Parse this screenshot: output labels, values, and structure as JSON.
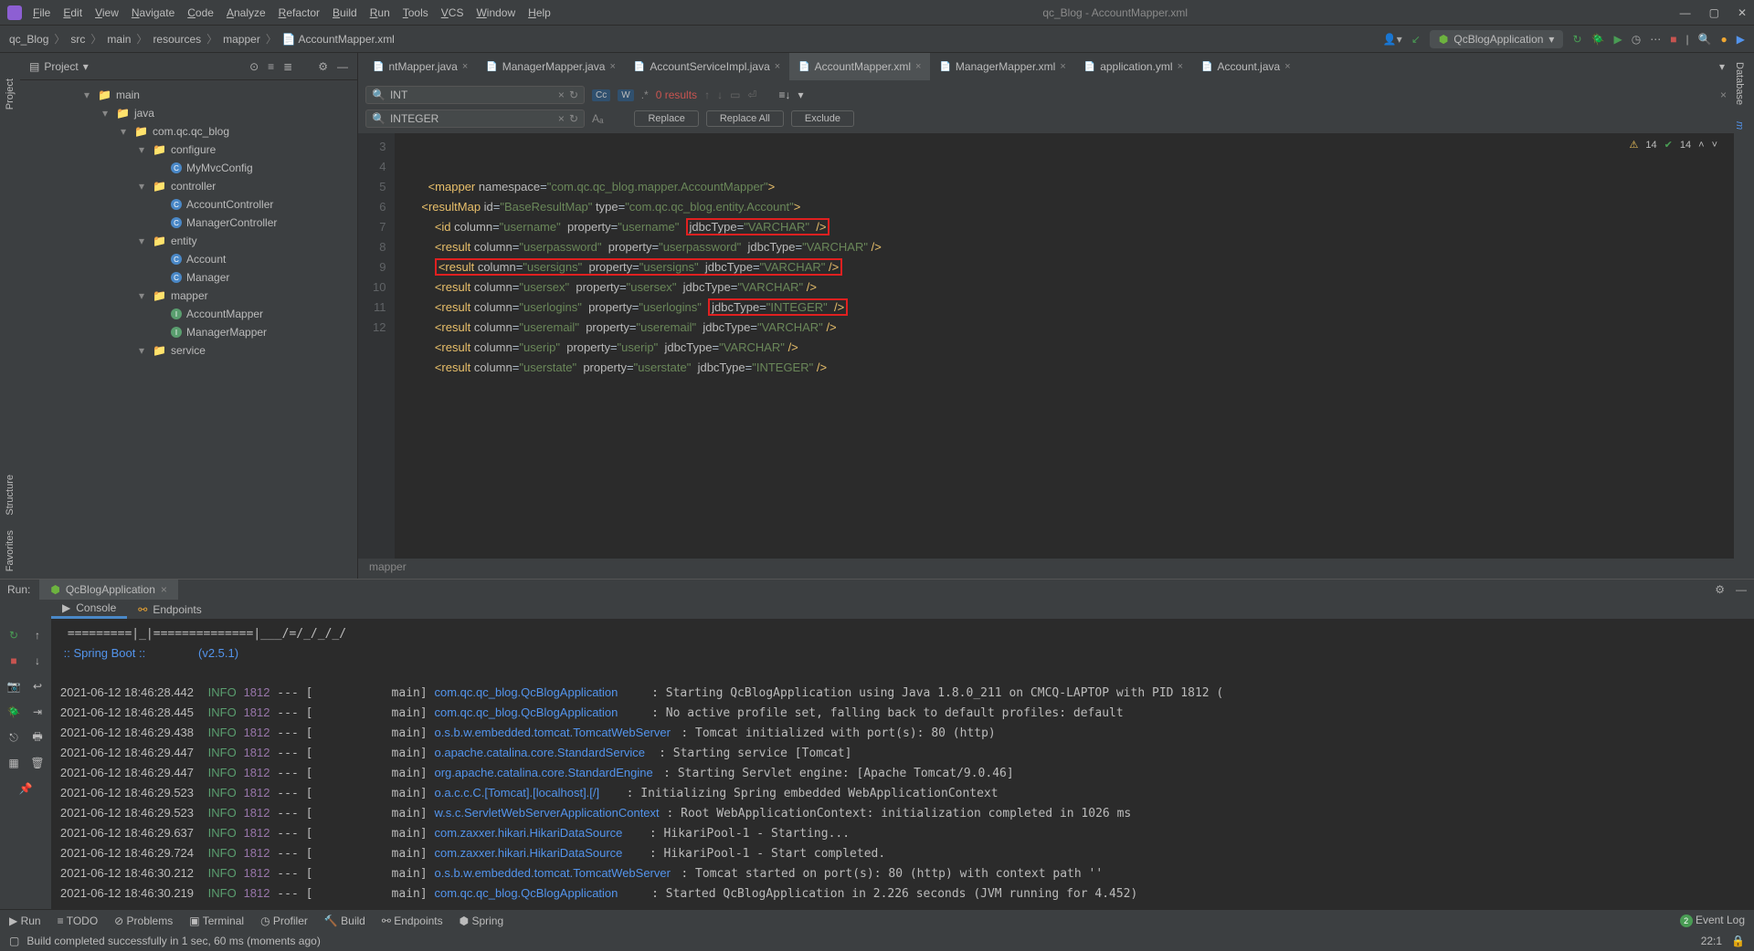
{
  "window": {
    "title": "qc_Blog - AccountMapper.xml"
  },
  "menu": [
    "File",
    "Edit",
    "View",
    "Navigate",
    "Code",
    "Analyze",
    "Refactor",
    "Build",
    "Run",
    "Tools",
    "VCS",
    "Window",
    "Help"
  ],
  "breadcrumb": [
    "qc_Blog",
    "src",
    "main",
    "resources",
    "mapper",
    "AccountMapper.xml"
  ],
  "runConfig": "QcBlogApplication",
  "projectPanel": {
    "title": "Project"
  },
  "tree": [
    {
      "indent": 70,
      "arrow": "▾",
      "icon": "folder",
      "label": "main"
    },
    {
      "indent": 90,
      "arrow": "▾",
      "icon": "folder",
      "label": "java",
      "color": "#4a88c7"
    },
    {
      "indent": 110,
      "arrow": "▾",
      "icon": "folder",
      "label": "com.qc.qc_blog"
    },
    {
      "indent": 130,
      "arrow": "▾",
      "icon": "folder",
      "label": "configure"
    },
    {
      "indent": 150,
      "arrow": "",
      "icon": "c",
      "label": "MyMvcConfig"
    },
    {
      "indent": 130,
      "arrow": "▾",
      "icon": "folder",
      "label": "controller"
    },
    {
      "indent": 150,
      "arrow": "",
      "icon": "c",
      "label": "AccountController"
    },
    {
      "indent": 150,
      "arrow": "",
      "icon": "c",
      "label": "ManagerController"
    },
    {
      "indent": 130,
      "arrow": "▾",
      "icon": "folder",
      "label": "entity"
    },
    {
      "indent": 150,
      "arrow": "",
      "icon": "c",
      "label": "Account"
    },
    {
      "indent": 150,
      "arrow": "",
      "icon": "c",
      "label": "Manager"
    },
    {
      "indent": 130,
      "arrow": "▾",
      "icon": "folder",
      "label": "mapper"
    },
    {
      "indent": 150,
      "arrow": "",
      "icon": "i",
      "label": "AccountMapper"
    },
    {
      "indent": 150,
      "arrow": "",
      "icon": "i",
      "label": "ManagerMapper"
    },
    {
      "indent": 130,
      "arrow": "▾",
      "icon": "folder",
      "label": "service"
    }
  ],
  "tabs": [
    {
      "label": "ntMapper.java",
      "active": false
    },
    {
      "label": "ManagerMapper.java",
      "active": false
    },
    {
      "label": "AccountServiceImpl.java",
      "active": false
    },
    {
      "label": "AccountMapper.xml",
      "active": true
    },
    {
      "label": "ManagerMapper.xml",
      "active": false
    },
    {
      "label": "application.yml",
      "active": false
    },
    {
      "label": "Account.java",
      "active": false
    }
  ],
  "search": {
    "find": "INT",
    "replace": "INTEGER",
    "results": "0 results",
    "buttons": [
      "Replace",
      "Replace All",
      "Exclude"
    ]
  },
  "lineNumbers": [
    "3",
    "4",
    "5",
    "6",
    "7",
    "8",
    "9",
    "10",
    "11",
    "12"
  ],
  "inspections": {
    "warn": "14",
    "pass": "14"
  },
  "code": {
    "mapperNs": "com.qc.qc_blog.mapper.AccountMapper",
    "resultMapId": "BaseResultMap",
    "resultMapType": "com.qc.qc_blog.entity.Account",
    "rows": [
      {
        "tag": "id",
        "col": "username",
        "prop": "username",
        "jdbc": "VARCHAR",
        "mark": "jdbc",
        "proplink": false
      },
      {
        "tag": "result",
        "col": "userpassword",
        "prop": "userpassword",
        "jdbc": "VARCHAR",
        "mark": "",
        "proplink": true
      },
      {
        "tag": "result",
        "col": "usersigns",
        "prop": "usersigns",
        "jdbc": "VARCHAR",
        "mark": "row",
        "proplink": true
      },
      {
        "tag": "result",
        "col": "usersex",
        "prop": "usersex",
        "jdbc": "VARCHAR",
        "mark": "",
        "proplink": true
      },
      {
        "tag": "result",
        "col": "userlogins",
        "prop": "userlogins",
        "jdbc": "INTEGER",
        "mark": "jdbc",
        "proplink": true
      },
      {
        "tag": "result",
        "col": "useremail",
        "prop": "useremail",
        "jdbc": "VARCHAR",
        "mark": "",
        "proplink": true
      },
      {
        "tag": "result",
        "col": "userip",
        "prop": "userip",
        "jdbc": "VARCHAR",
        "mark": "",
        "proplink": true
      },
      {
        "tag": "result",
        "col": "userstate",
        "prop": "userstate",
        "jdbc": "INTEGER",
        "mark": "",
        "proplink": true
      }
    ]
  },
  "breadcrumbBottom": "mapper",
  "runLabel": "Run:",
  "runTab": "QcBlogApplication",
  "console": {
    "banner1": "=========|_|==============|___/=/_/_/_/",
    "banner2": " :: Spring Boot ::                (v2.5.1)",
    "lines": [
      {
        "ts": "2021-06-12 18:46:28.442",
        "lvl": "INFO",
        "pid": "1812",
        "thr": "main",
        "cls": "com.qc.qc_blog.QcBlogApplication",
        "msg": "Starting QcBlogApplication using Java 1.8.0_211 on CMCQ-LAPTOP with PID 1812 ("
      },
      {
        "ts": "2021-06-12 18:46:28.445",
        "lvl": "INFO",
        "pid": "1812",
        "thr": "main",
        "cls": "com.qc.qc_blog.QcBlogApplication",
        "msg": "No active profile set, falling back to default profiles: default"
      },
      {
        "ts": "2021-06-12 18:46:29.438",
        "lvl": "INFO",
        "pid": "1812",
        "thr": "main",
        "cls": "o.s.b.w.embedded.tomcat.TomcatWebServer",
        "msg": "Tomcat initialized with port(s): 80 (http)"
      },
      {
        "ts": "2021-06-12 18:46:29.447",
        "lvl": "INFO",
        "pid": "1812",
        "thr": "main",
        "cls": "o.apache.catalina.core.StandardService",
        "msg": "Starting service [Tomcat]"
      },
      {
        "ts": "2021-06-12 18:46:29.447",
        "lvl": "INFO",
        "pid": "1812",
        "thr": "main",
        "cls": "org.apache.catalina.core.StandardEngine",
        "msg": "Starting Servlet engine: [Apache Tomcat/9.0.46]"
      },
      {
        "ts": "2021-06-12 18:46:29.523",
        "lvl": "INFO",
        "pid": "1812",
        "thr": "main",
        "cls": "o.a.c.c.C.[Tomcat].[localhost].[/]",
        "msg": "Initializing Spring embedded WebApplicationContext"
      },
      {
        "ts": "2021-06-12 18:46:29.523",
        "lvl": "INFO",
        "pid": "1812",
        "thr": "main",
        "cls": "w.s.c.ServletWebServerApplicationContext",
        "msg": "Root WebApplicationContext: initialization completed in 1026 ms"
      },
      {
        "ts": "2021-06-12 18:46:29.637",
        "lvl": "INFO",
        "pid": "1812",
        "thr": "main",
        "cls": "com.zaxxer.hikari.HikariDataSource",
        "msg": "HikariPool-1 - Starting..."
      },
      {
        "ts": "2021-06-12 18:46:29.724",
        "lvl": "INFO",
        "pid": "1812",
        "thr": "main",
        "cls": "com.zaxxer.hikari.HikariDataSource",
        "msg": "HikariPool-1 - Start completed."
      },
      {
        "ts": "2021-06-12 18:46:30.212",
        "lvl": "INFO",
        "pid": "1812",
        "thr": "main",
        "cls": "o.s.b.w.embedded.tomcat.TomcatWebServer",
        "msg": "Tomcat started on port(s): 80 (http) with context path ''"
      },
      {
        "ts": "2021-06-12 18:46:30.219",
        "lvl": "INFO",
        "pid": "1812",
        "thr": "main",
        "cls": "com.qc.qc_blog.QcBlogApplication",
        "msg": "Started QcBlogApplication in 2.226 seconds (JVM running for 4.452)"
      }
    ]
  },
  "subtabs": [
    "Console",
    "Endpoints"
  ],
  "statusbar": {
    "items": [
      "Run",
      "TODO",
      "Problems",
      "Terminal",
      "Profiler",
      "Build",
      "Endpoints",
      "Spring"
    ],
    "eventLog": "Event Log",
    "pos": "22:1"
  },
  "msg": "Build completed successfully in 1 sec, 60 ms (moments ago)"
}
